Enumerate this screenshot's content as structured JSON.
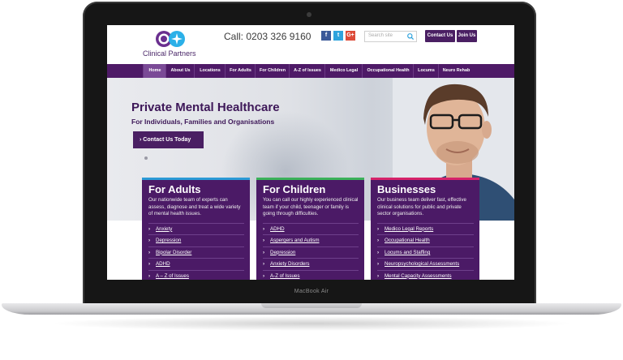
{
  "device": {
    "brand_label": "MacBook Air"
  },
  "header": {
    "logo_text": "Clinical Partners",
    "phone": "Call: 0203 326 9160",
    "social": [
      "f",
      "t",
      "G+"
    ],
    "search_placeholder": "Search site",
    "buttons": [
      "Contact Us",
      "Join Us"
    ]
  },
  "nav": {
    "items": [
      "Home",
      "About Us",
      "Locations",
      "For Adults",
      "For Children",
      "A-Z of Issues",
      "Medico Legal",
      "Occupational Health",
      "Locums",
      "Neuro Rehab"
    ],
    "active": "Home"
  },
  "hero": {
    "title": "Private Mental Healthcare",
    "subtitle": "For Individuals, Families and Organisations",
    "cta": "Contact Us Today"
  },
  "cards": [
    {
      "title": "For Adults",
      "description": "Our nationwide team of experts can assess, diagnose and treat a wide variety of mental health issues.",
      "links": [
        "Anxiety",
        "Depression",
        "Bipolar Disorder",
        "ADHD",
        "A – Z of Issues"
      ],
      "accent": "#2b9ad6"
    },
    {
      "title": "For Children",
      "description": "You can call our highly experienced clinical team if your child, teenager or family is going through difficulties.",
      "links": [
        "ADHD",
        "Aspergers and Autism",
        "Depression",
        "Anxiety Disorders",
        "A-Z of Issues"
      ],
      "accent": "#3bb15a"
    },
    {
      "title": "Businesses",
      "description": "Our business team deliver fast, effective clinical solutions for public and private sector organisations.",
      "links": [
        "Medico Legal Reports",
        "Occupational Health",
        "Locums and Staffing",
        "Neuropsychological Assessments",
        "Mental Capacity Assessments"
      ],
      "accent": "#d6236a"
    }
  ],
  "colors": {
    "brand_purple": "#4e1a67",
    "facebook": "#3b5998",
    "twitter": "#2fa3dd",
    "google": "#dd4b39"
  }
}
